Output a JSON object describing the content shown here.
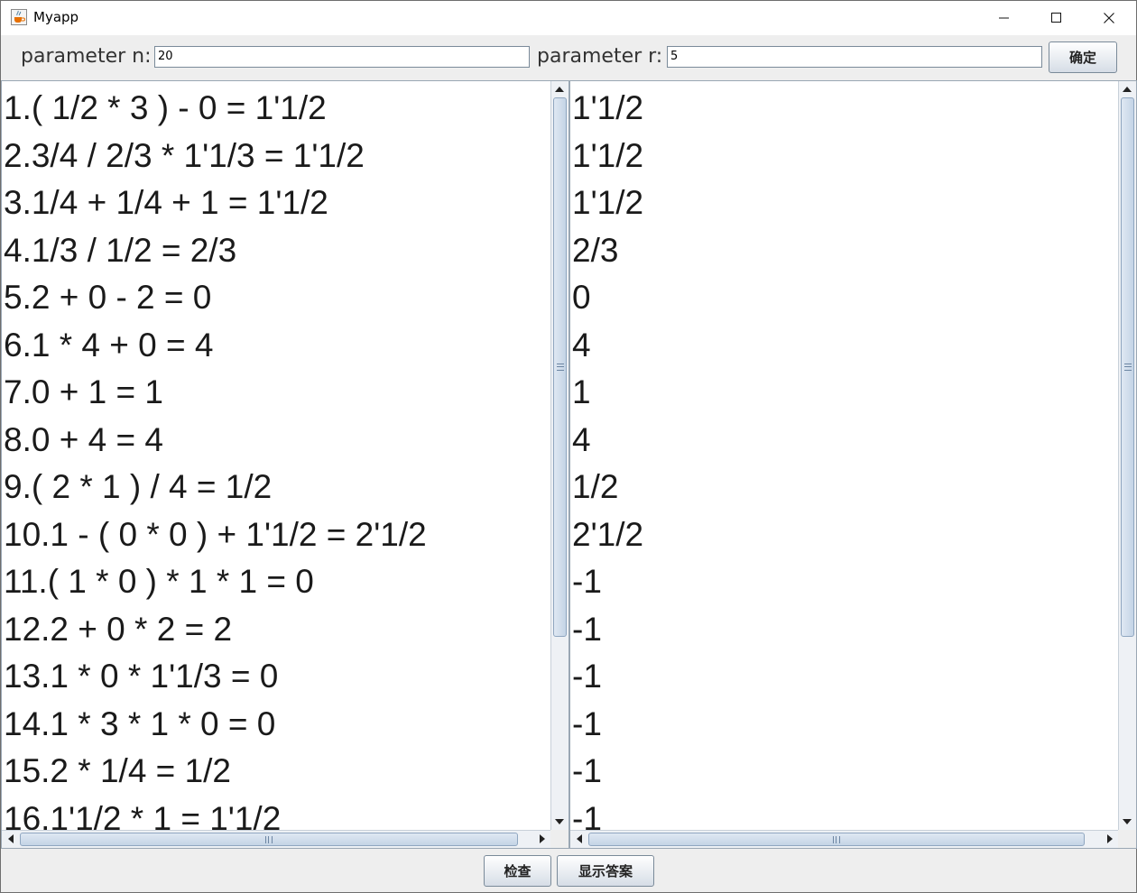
{
  "window": {
    "title": "Myapp",
    "icons": {
      "app": "java-cup-icon",
      "minimize": "minimize-icon",
      "maximize": "maximize-icon",
      "close": "close-icon"
    }
  },
  "params": {
    "n_label": "parameter n:",
    "n_value": "20",
    "r_label": "parameter r:",
    "r_value": "5",
    "confirm_label": "确定"
  },
  "exercises": [
    "1.( 1/2 * 3 ) - 0 = 1'1/2",
    "2.3/4 / 2/3 * 1'1/3 = 1'1/2",
    "3.1/4 + 1/4 + 1 = 1'1/2",
    "4.1/3 / 1/2 = 2/3",
    "5.2 + 0 - 2 = 0",
    "6.1 * 4 + 0 = 4",
    "7.0 + 1 = 1",
    "8.0 + 4 = 4",
    "9.( 2 * 1 ) / 4 = 1/2",
    "10.1 - ( 0 * 0 ) + 1'1/2 = 2'1/2",
    "11.( 1 * 0 ) * 1 * 1 = 0",
    "12.2 + 0 * 2 = 2",
    "13.1 * 0 * 1'1/3 = 0",
    "14.1 * 3 * 1 * 0 = 0",
    "15.2 * 1/4 = 1/2",
    "16.1'1/2 * 1 = 1'1/2"
  ],
  "answers": [
    "1'1/2",
    "1'1/2",
    "1'1/2",
    "2/3",
    "0",
    "4",
    "1",
    "4",
    "1/2",
    "2'1/2",
    "-1",
    "-1",
    "-1",
    "-1",
    "-1",
    "-1"
  ],
  "buttons": {
    "check_label": "检查",
    "show_answer_label": "显示答案"
  },
  "colors": {
    "background": "#eeeeee",
    "button_border": "#7a8a99",
    "scroll_thumb": "#c4d4e6"
  }
}
